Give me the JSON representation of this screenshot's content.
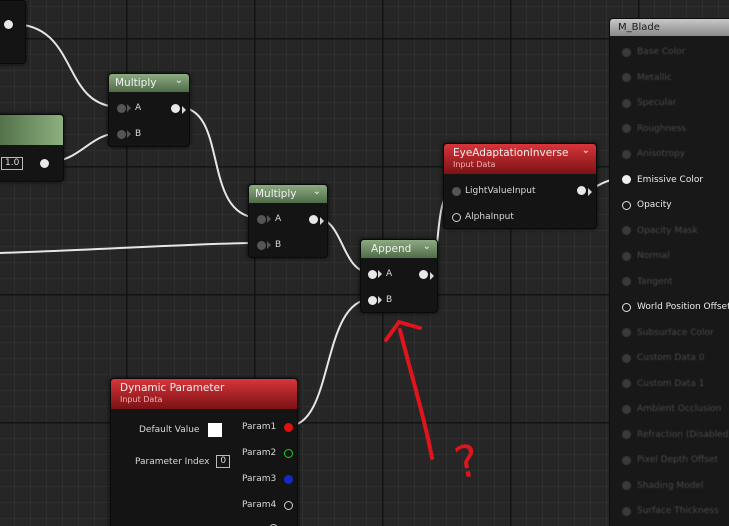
{
  "nodes": {
    "multiply1": {
      "title": "Multiply",
      "pin_a": "A",
      "pin_b": "B"
    },
    "multiply2": {
      "title": "Multiply",
      "pin_a": "A",
      "pin_b": "B"
    },
    "append": {
      "title": "Append",
      "pin_a": "A",
      "pin_b": "B"
    },
    "left_const": {
      "value": "1.0"
    },
    "eye_adaptation": {
      "title": "EyeAdaptationInverse",
      "subtitle": "Input Data",
      "pins": [
        "LightValueInput",
        "AlphaInput"
      ]
    },
    "dynamic_parameter": {
      "title": "Dynamic Parameter",
      "subtitle": "Input Data",
      "default_value_label": "Default Value",
      "parameter_index_label": "Parameter Index",
      "parameter_index_value": "0",
      "outputs": [
        "Param1",
        "Param2",
        "Param3",
        "Param4"
      ]
    }
  },
  "result_node": {
    "title": "M_Blade",
    "pins": [
      "Base Color",
      "Metallic",
      "Specular",
      "Roughness",
      "Anisotropy",
      "Emissive Color",
      "Opacity",
      "Opacity Mask",
      "Normal",
      "Tangent",
      "World Position Offset",
      "Subsurface Color",
      "Custom Data 0",
      "Custom Data 1",
      "Ambient Occlusion",
      "Refraction (Disabled)",
      "Pixel Depth Offset",
      "Shading Model",
      "Surface Thickness"
    ]
  },
  "annotation": {
    "mark": "?",
    "color": "#e0141c"
  },
  "colors": {
    "green_header": "#6b8a62",
    "red_header": "#b31c20",
    "wire": "#e8e8e8",
    "grid_bg": "#262626"
  }
}
